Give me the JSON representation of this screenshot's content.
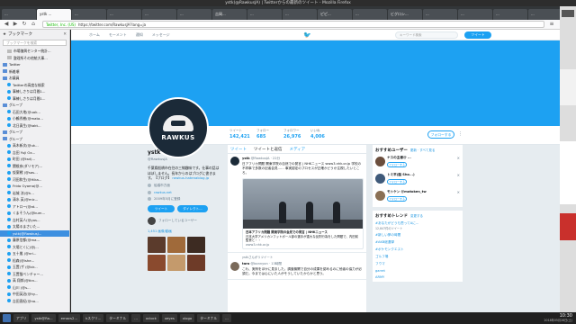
{
  "window": {
    "title": "ystk(@RawkusJA) | Twitterからの最新のツイート - Mozilla Firefox"
  },
  "tabs": [
    "...",
    "ystk ...",
    "...",
    "...",
    "...",
    "...",
    "吉岡...",
    "...",
    "...",
    "ピピ...",
    "...",
    "ビグロシ...",
    "...",
    "...",
    "...",
    "...",
    "大...",
    "吉宗...",
    "..."
  ],
  "nav": {
    "identity": "Twitter, Inc. (US)",
    "url": "https://twitter.com/RawkusJA?lang=ja"
  },
  "sidebar": {
    "title": "ブックマーク",
    "search_placeholder": "ブックマークを検索",
    "items": [
      {
        "label": "市場復興センター統計...",
        "type": "page"
      },
      {
        "label": "整理所その他統大事...",
        "type": "page"
      },
      {
        "label": "Twitter",
        "type": "folder"
      },
      {
        "label": "新着順",
        "type": "folder"
      },
      {
        "label": "お議員",
        "type": "folder"
      },
      {
        "label": "Twitterの高度な検索",
        "type": "bird"
      },
      {
        "label": "事練しさりは月間1...",
        "type": "bird"
      },
      {
        "label": "事練しさりは月間1...",
        "type": "bird"
      },
      {
        "label": "グループ",
        "type": "folder"
      },
      {
        "label": "石田大地(@uak...",
        "type": "bird"
      },
      {
        "label": "小鶴秀樹(@mata...",
        "type": "bird"
      },
      {
        "label": "北日真生(@takt...",
        "type": "bird"
      },
      {
        "label": "グループ",
        "type": "folder"
      },
      {
        "label": "グループ",
        "type": "folder"
      },
      {
        "label": "高木新次(@uk...",
        "type": "bird"
      },
      {
        "label": "吉田 Yuji Ox...",
        "type": "bird"
      },
      {
        "label": "町田 (@tsd)...",
        "type": "bird"
      },
      {
        "label": "関根彦(ダリモア)...",
        "type": "bird"
      },
      {
        "label": "仮案戦 (@sas...",
        "type": "bird"
      },
      {
        "label": "河田和生(@Hika...",
        "type": "bird"
      },
      {
        "label": "Frida Oyama(@...",
        "type": "bird"
      },
      {
        "label": "岩城 涼(@h...",
        "type": "bird"
      },
      {
        "label": "清水 英(@mic...",
        "type": "bird"
      },
      {
        "label": "アトロー(@at...",
        "type": "bird"
      },
      {
        "label": "くまそうん(@kum...",
        "type": "bird"
      },
      {
        "label": "吉村英人(@yos...",
        "type": "bird"
      },
      {
        "label": "太陽るまさいた...",
        "type": "bird"
      },
      {
        "label": "ystk(@RawkusJ...",
        "type": "bird",
        "selected": true
      },
      {
        "label": "藤原信都(@ma...",
        "type": "bird"
      },
      {
        "label": "大場とくに(@j...",
        "type": "bird"
      },
      {
        "label": "五十嵐 (@nri...",
        "type": "bird"
      },
      {
        "label": "松森(@ishe...",
        "type": "bird"
      },
      {
        "label": "玉置(ザ (@bir...",
        "type": "bird"
      },
      {
        "label": "玉置猫ベンチャー...",
        "type": "bird"
      },
      {
        "label": "高 翔郎(@tkn...",
        "type": "bird"
      },
      {
        "label": "山川 (@s...",
        "type": "bird"
      },
      {
        "label": "中田英治(@hy...",
        "type": "bird"
      },
      {
        "label": "吉田直紀(@no...",
        "type": "bird"
      }
    ]
  },
  "twitter": {
    "nav": [
      "ホーム",
      "モーメント",
      "通知",
      "メッセージ"
    ],
    "search_placeholder": "キーワード検索",
    "tweet_button": "ツイート",
    "avatar_text": "RAWKUS",
    "stats": [
      {
        "label": "ツイート",
        "value": "142,421"
      },
      {
        "label": "フォロー",
        "value": "685"
      },
      {
        "label": "フォロワー",
        "value": "26,976"
      },
      {
        "label": "いいね",
        "value": "4,006"
      }
    ],
    "follow_button": "フォローする",
    "profile": {
      "name": "ystk",
      "handle": "@RawkusJA",
      "bio": "千葉県船橋市在住の三線趣味です。仕事の話はほぼしません。長年からのはブログに書きます。【ブログ】",
      "bio_link": "rawkus.hatenablog.jp",
      "location": "船橋市方面",
      "website": "rawkus.net",
      "joined": "2009年5月に登録",
      "tweet_button": "ツイート",
      "dm_button": "ダイレクト...",
      "known": "フォローしているユーザー",
      "photos": "1,451 画像/動画"
    },
    "timeline": {
      "tabs": [
        "ツイート",
        "ツイートと返信",
        "メディア"
      ],
      "tweets": [
        {
          "name": "ystk",
          "handle": "@RawkusJA · 22分",
          "body": "日アフリカ問題 関東学院の自然での発言 | NHKニュース www3.nhk.or.jp 学校の不祥事で多数の記者会見…… 事実認定のプロセスが正確かどうか注視したいところ。",
          "card_title": "日本アフリカ問題 関東学院の会見での発言 | NHKニュース",
          "card_desc": "日本大学アメリカンフットボール部の選手が重大な反則行為をした問題で、内田前監督と・・",
          "card_domain": "www3.nhk.or.jp"
        },
        {
          "retweet": "ystkさんがリツイート",
          "name": "taro",
          "handle": "@bonnyon · 13時間",
          "body": "これ、実例をほかに見ました。調査機関で自分の成果を認めるのに他者の協力が必須だ。今までは心にいた人がそうしていたからかと思う。"
        }
      ]
    },
    "suggest": {
      "title": "おすすめユーザー",
      "sub": "更新 · すべて見る",
      "users": [
        {
          "name": "ナスの主様@ ...",
          "follow": "フォローする"
        },
        {
          "name": "トミ平(脳 Sho...)",
          "follow": "フォローする"
        },
        {
          "name": "モトケン @motoken_tw",
          "follow": "フォローする"
        }
      ]
    },
    "trends": {
      "title": "おすすめトレンド",
      "sub": "変更する",
      "items": [
        {
          "name": "#あなたがどうも思ってAに...",
          "count": "12,847件のツイート"
        },
        {
          "name": "#新しい夢の時間",
          "count": ""
        },
        {
          "name": "#AKB総選挙",
          "count": ""
        },
        {
          "name": "#ポケモンクエスト",
          "count": ""
        },
        {
          "name": "ゴルフ場",
          "count": ""
        },
        {
          "name": "フウマ",
          "count": ""
        },
        {
          "name": "garret",
          "count": ""
        },
        {
          "name": "ARMY",
          "count": ""
        }
      ]
    }
  },
  "taskbar": {
    "items": [
      "アプリ",
      "ystk@Ra...",
      "emacs2...",
      "kスクリ...",
      "ターミナル",
      "...",
      "xclock",
      "xeyes",
      "xlogo",
      "ターミナル",
      "..."
    ],
    "time": "10:30",
    "date": "2018年05月26日(土)"
  }
}
